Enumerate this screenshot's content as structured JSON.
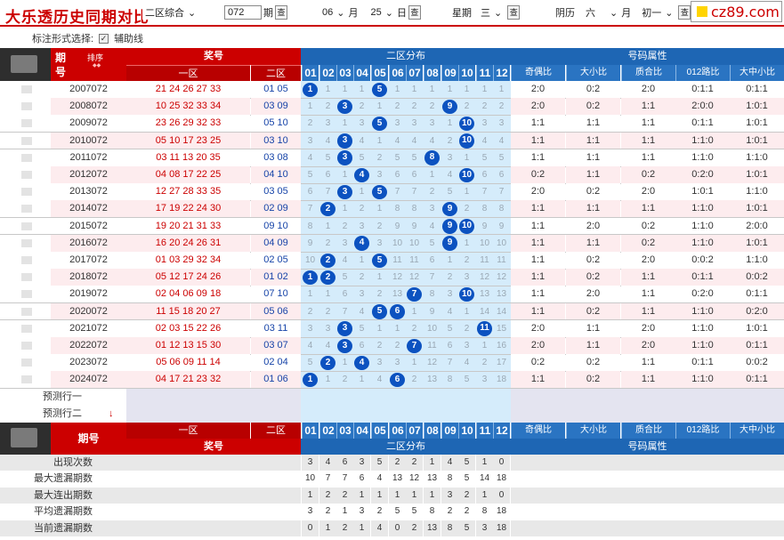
{
  "header": {
    "title": "大乐透历史同期对比",
    "mode_select": "二区综合",
    "issue_value": "072",
    "issue_suffix": "期",
    "month_value": "06",
    "month_suffix": "月",
    "day_value": "25",
    "day_suffix": "日",
    "week_label": "星期",
    "week_value": "三",
    "lunar_label": "阴历",
    "lunar_month": "六",
    "lunar_month_suffix": "月",
    "lunar_day": "初一",
    "query_btn": "查",
    "logo_text": "cz89.com"
  },
  "options": {
    "label": "标注形式选择:",
    "assist_line": "辅助线",
    "checked": "✓"
  },
  "columns": {
    "issue_top": "期",
    "issue_bottom": "号",
    "sort_label": "排序",
    "prize": "奖号",
    "zone1": "一区",
    "zone2": "二区",
    "dist_title": "二区分布",
    "nums": [
      "01",
      "02",
      "03",
      "04",
      "05",
      "06",
      "07",
      "08",
      "09",
      "10",
      "11",
      "12"
    ],
    "attr_title": "号码属性",
    "attrs": [
      "奇偶比",
      "大小比",
      "质合比",
      "012路比",
      "大中小比"
    ],
    "issue_footer": "期号"
  },
  "rows": [
    {
      "issue": "2007072",
      "front": "21 24 26 27 33",
      "back": "01 05",
      "dist": [
        "1",
        "1",
        "1",
        "1",
        "5",
        "1",
        "1",
        "1",
        "1",
        "1",
        "1",
        "1"
      ],
      "hits": [
        1,
        5
      ],
      "attrs": [
        "2:0",
        "0:2",
        "2:0",
        "0:1:1",
        "0:1:1"
      ]
    },
    {
      "issue": "2008072",
      "front": "10 25 32 33 34",
      "back": "03 09",
      "dist": [
        "1",
        "2",
        "3",
        "2",
        "1",
        "2",
        "2",
        "2",
        "9",
        "2",
        "2",
        "2"
      ],
      "hits": [
        3,
        9
      ],
      "attrs": [
        "2:0",
        "0:2",
        "1:1",
        "2:0:0",
        "1:0:1"
      ]
    },
    {
      "issue": "2009072",
      "front": "23 26 29 32 33",
      "back": "05 10",
      "dist": [
        "2",
        "3",
        "1",
        "3",
        "5",
        "3",
        "3",
        "3",
        "1",
        "10",
        "3",
        "3"
      ],
      "hits": [
        5,
        10
      ],
      "attrs": [
        "1:1",
        "1:1",
        "1:1",
        "0:1:1",
        "1:0:1"
      ]
    },
    {
      "issue": "2010072",
      "front": "05 10 17 23 25",
      "back": "03 10",
      "dist": [
        "3",
        "4",
        "3",
        "4",
        "1",
        "4",
        "4",
        "4",
        "2",
        "10",
        "4",
        "4"
      ],
      "hits": [
        3,
        10
      ],
      "attrs": [
        "1:1",
        "1:1",
        "1:1",
        "1:1:0",
        "1:0:1"
      ]
    },
    {
      "issue": "2011072",
      "front": "03 11 13 20 35",
      "back": "03 08",
      "dist": [
        "4",
        "5",
        "3",
        "5",
        "2",
        "5",
        "5",
        "8",
        "3",
        "1",
        "5",
        "5"
      ],
      "hits": [
        3,
        8
      ],
      "attrs": [
        "1:1",
        "1:1",
        "1:1",
        "1:1:0",
        "1:1:0"
      ]
    },
    {
      "issue": "2012072",
      "front": "04 08 17 22 25",
      "back": "04 10",
      "dist": [
        "5",
        "6",
        "1",
        "4",
        "3",
        "6",
        "6",
        "1",
        "4",
        "10",
        "6",
        "6"
      ],
      "hits": [
        4,
        10
      ],
      "attrs": [
        "0:2",
        "1:1",
        "0:2",
        "0:2:0",
        "1:0:1"
      ]
    },
    {
      "issue": "2013072",
      "front": "12 27 28 33 35",
      "back": "03 05",
      "dist": [
        "6",
        "7",
        "3",
        "1",
        "5",
        "7",
        "7",
        "2",
        "5",
        "1",
        "7",
        "7"
      ],
      "hits": [
        3,
        5
      ],
      "attrs": [
        "2:0",
        "0:2",
        "2:0",
        "1:0:1",
        "1:1:0"
      ]
    },
    {
      "issue": "2014072",
      "front": "17 19 22 24 30",
      "back": "02 09",
      "dist": [
        "7",
        "2",
        "1",
        "2",
        "1",
        "8",
        "8",
        "3",
        "9",
        "2",
        "8",
        "8"
      ],
      "hits": [
        2,
        9
      ],
      "attrs": [
        "1:1",
        "1:1",
        "1:1",
        "1:1:0",
        "1:0:1"
      ]
    },
    {
      "issue": "2015072",
      "front": "19 20 21 31 33",
      "back": "09 10",
      "dist": [
        "8",
        "1",
        "2",
        "3",
        "2",
        "9",
        "9",
        "4",
        "9",
        "10",
        "9",
        "9"
      ],
      "hits": [
        9,
        10
      ],
      "attrs": [
        "1:1",
        "2:0",
        "0:2",
        "1:1:0",
        "2:0:0"
      ]
    },
    {
      "issue": "2016072",
      "front": "16 20 24 26 31",
      "back": "04 09",
      "dist": [
        "9",
        "2",
        "3",
        "4",
        "3",
        "10",
        "10",
        "5",
        "9",
        "1",
        "10",
        "10"
      ],
      "hits": [
        4,
        9
      ],
      "attrs": [
        "1:1",
        "1:1",
        "0:2",
        "1:1:0",
        "1:0:1"
      ]
    },
    {
      "issue": "2017072",
      "front": "01 03 29 32 34",
      "back": "02 05",
      "dist": [
        "10",
        "2",
        "4",
        "1",
        "5",
        "11",
        "11",
        "6",
        "1",
        "2",
        "11",
        "11"
      ],
      "hits": [
        2,
        5
      ],
      "attrs": [
        "1:1",
        "0:2",
        "2:0",
        "0:0:2",
        "1:1:0"
      ]
    },
    {
      "issue": "2018072",
      "front": "05 12 17 24 26",
      "back": "01 02",
      "dist": [
        "1",
        "2",
        "5",
        "2",
        "1",
        "12",
        "12",
        "7",
        "2",
        "3",
        "12",
        "12"
      ],
      "hits": [
        1,
        2
      ],
      "attrs": [
        "1:1",
        "0:2",
        "1:1",
        "0:1:1",
        "0:0:2"
      ]
    },
    {
      "issue": "2019072",
      "front": "02 04 06 09 18",
      "back": "07 10",
      "dist": [
        "1",
        "1",
        "6",
        "3",
        "2",
        "13",
        "7",
        "8",
        "3",
        "10",
        "13",
        "13"
      ],
      "hits": [
        7,
        10
      ],
      "attrs": [
        "1:1",
        "2:0",
        "1:1",
        "0:2:0",
        "0:1:1"
      ]
    },
    {
      "issue": "2020072",
      "front": "11 15 18 20 27",
      "back": "05 06",
      "dist": [
        "2",
        "2",
        "7",
        "4",
        "5",
        "6",
        "1",
        "9",
        "4",
        "1",
        "14",
        "14"
      ],
      "hits": [
        5,
        6
      ],
      "attrs": [
        "1:1",
        "0:2",
        "1:1",
        "1:1:0",
        "0:2:0"
      ]
    },
    {
      "issue": "2021072",
      "front": "02 03 15 22 26",
      "back": "03 11",
      "dist": [
        "3",
        "3",
        "3",
        "5",
        "1",
        "1",
        "2",
        "10",
        "5",
        "2",
        "11",
        "15"
      ],
      "hits": [
        3,
        11
      ],
      "attrs": [
        "2:0",
        "1:1",
        "2:0",
        "1:1:0",
        "1:0:1"
      ]
    },
    {
      "issue": "2022072",
      "front": "01 12 13 15 30",
      "back": "03 07",
      "dist": [
        "4",
        "4",
        "3",
        "6",
        "2",
        "2",
        "7",
        "11",
        "6",
        "3",
        "1",
        "16"
      ],
      "hits": [
        3,
        7
      ],
      "attrs": [
        "2:0",
        "1:1",
        "2:0",
        "1:1:0",
        "0:1:1"
      ]
    },
    {
      "issue": "2023072",
      "front": "05 06 09 11 14",
      "back": "02 04",
      "dist": [
        "5",
        "2",
        "1",
        "4",
        "3",
        "3",
        "1",
        "12",
        "7",
        "4",
        "2",
        "17"
      ],
      "hits": [
        2,
        4
      ],
      "attrs": [
        "0:2",
        "0:2",
        "1:1",
        "0:1:1",
        "0:0:2"
      ]
    },
    {
      "issue": "2024072",
      "front": "04 17 21 23 32",
      "back": "01 06",
      "dist": [
        "1",
        "1",
        "2",
        "1",
        "4",
        "6",
        "2",
        "13",
        "8",
        "5",
        "3",
        "18"
      ],
      "hits": [
        1,
        6
      ],
      "attrs": [
        "1:1",
        "0:2",
        "1:1",
        "1:1:0",
        "0:1:1"
      ]
    }
  ],
  "predict": {
    "row1": "预测行一",
    "row2": "预测行二",
    "arrow": "↓"
  },
  "stats": [
    {
      "label": "出现次数",
      "values": [
        "3",
        "4",
        "6",
        "3",
        "5",
        "2",
        "2",
        "1",
        "4",
        "5",
        "1",
        "0"
      ]
    },
    {
      "label": "最大遗漏期数",
      "values": [
        "10",
        "7",
        "7",
        "6",
        "4",
        "13",
        "12",
        "13",
        "8",
        "5",
        "14",
        "18"
      ]
    },
    {
      "label": "最大连出期数",
      "values": [
        "1",
        "2",
        "2",
        "1",
        "1",
        "1",
        "1",
        "1",
        "3",
        "2",
        "1",
        "0"
      ]
    },
    {
      "label": "平均遗漏期数",
      "values": [
        "3",
        "2",
        "1",
        "3",
        "2",
        "5",
        "5",
        "8",
        "2",
        "2",
        "8",
        "18"
      ]
    },
    {
      "label": "当前遗漏期数",
      "values": [
        "0",
        "1",
        "2",
        "1",
        "4",
        "0",
        "2",
        "13",
        "8",
        "5",
        "3",
        "18"
      ]
    }
  ],
  "colors": {
    "red": "#cc0000",
    "blue": "#1e66b4",
    "ball": "#0c52c0",
    "zone_bg": "#d5ecfb",
    "row_pink": "#fdecee"
  }
}
